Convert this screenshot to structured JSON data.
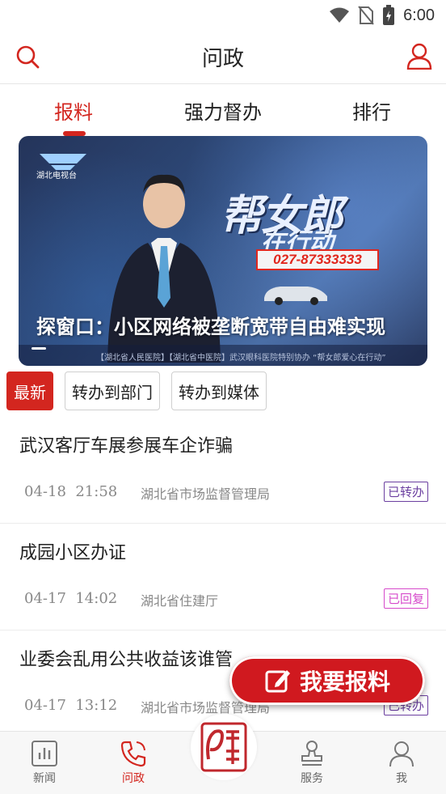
{
  "status_bar": {
    "time": "6:00"
  },
  "header": {
    "title": "问政",
    "search_icon": "search-icon",
    "user_icon": "user-icon",
    "accent": "#d3261f"
  },
  "tabs": [
    {
      "label": "报料",
      "active": true
    },
    {
      "label": "强力督办",
      "active": false
    },
    {
      "label": "排行",
      "active": false
    }
  ],
  "banner": {
    "channel_logo": "湖北电视台",
    "show_title": "帮女郎",
    "show_subtitle": "在行动",
    "hotline": "027-87333333",
    "caption": "探窗口：小区网络被垄断宽带自由难实现",
    "ticker": "【湖北省人民医院】【湖北省中医院】武汉眼科医院特别协办 “帮女郎爱心在行动”"
  },
  "filters": [
    {
      "label": "最新",
      "active": true
    },
    {
      "label": "转办到部门",
      "active": false
    },
    {
      "label": "转办到媒体",
      "active": false
    }
  ],
  "news": [
    {
      "title": "武汉客厅车展参展车企诈骗",
      "date": "04-18",
      "time": "21:58",
      "dept": "湖北省市场监督管理局",
      "status": "已转办",
      "status_type": "forwarded"
    },
    {
      "title": "成园小区办证",
      "date": "04-17",
      "time": "14:02",
      "dept": "湖北省住建厅",
      "status": "已回复",
      "status_type": "replied"
    },
    {
      "title": "业委会乱用公共收益该谁管",
      "date": "04-17",
      "time": "13:12",
      "dept": "湖北省市场监督管理局",
      "status": "已转办",
      "status_type": "forwarded"
    }
  ],
  "report_button": {
    "label": "我要报料",
    "icon": "edit-icon",
    "color": "#d0191f"
  },
  "bottom_nav": [
    {
      "label": "新闻",
      "icon": "news-chart-icon",
      "active": false
    },
    {
      "label": "问政",
      "icon": "phone-icon",
      "active": true
    },
    {
      "label": "",
      "icon": "seal-logo-icon",
      "active": false
    },
    {
      "label": "服务",
      "icon": "stamp-icon",
      "active": false
    },
    {
      "label": "我",
      "icon": "person-icon",
      "active": false
    }
  ]
}
